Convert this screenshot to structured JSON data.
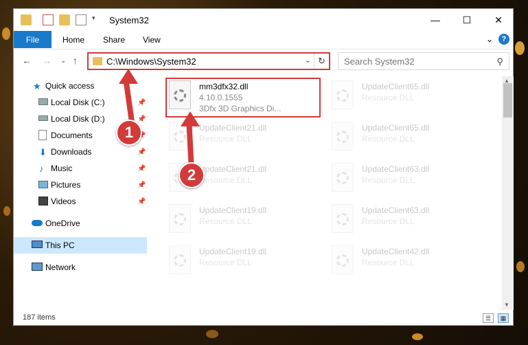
{
  "window": {
    "title": "System32",
    "minimize": "—",
    "maximize": "☐",
    "close": "✕"
  },
  "ribbon": {
    "tabs": [
      "File",
      "Home",
      "Share",
      "View"
    ],
    "expand": "⌄",
    "help": "?"
  },
  "nav": {
    "back": "←",
    "forward": "→",
    "recent": "⌄",
    "up": "↑",
    "address": "C:\\Windows\\System32",
    "search_placeholder": "Search System32"
  },
  "sidebar": {
    "items": [
      {
        "label": "Quick access",
        "icon": "star-icon",
        "pinned": false
      },
      {
        "label": "Local Disk (C:)",
        "icon": "drive-icon",
        "pinned": true
      },
      {
        "label": "Local Disk (D:)",
        "icon": "drive-icon",
        "pinned": true
      },
      {
        "label": "Documents",
        "icon": "document-icon",
        "pinned": true
      },
      {
        "label": "Downloads",
        "icon": "download-icon",
        "pinned": true
      },
      {
        "label": "Music",
        "icon": "music-icon",
        "pinned": true
      },
      {
        "label": "Pictures",
        "icon": "pictures-icon",
        "pinned": true
      },
      {
        "label": "Videos",
        "icon": "video-icon",
        "pinned": true
      },
      {
        "label": "OneDrive",
        "icon": "cloud-icon",
        "pinned": false
      },
      {
        "label": "This PC",
        "icon": "computer-icon",
        "pinned": false,
        "selected": true
      },
      {
        "label": "Network",
        "icon": "network-icon",
        "pinned": false
      }
    ]
  },
  "files": {
    "highlighted": {
      "name": "mm3dfx32.dll",
      "version": "4.10.0.1555",
      "desc": "3Dfx 3D Graphics Di..."
    },
    "left_column": [
      {
        "name": "UpdateClient21.dll",
        "type": "Resource DLL"
      },
      {
        "name": "UpdateClient21.dll",
        "type": "Resource DLL"
      },
      {
        "name": "UpdateClient19.dll",
        "type": "Resource DLL"
      },
      {
        "name": "UpdateClient19.dll",
        "type": "Resource DLL"
      }
    ],
    "right_column": [
      {
        "name": "UpdateClient65.dll",
        "type": "Resource DLL"
      },
      {
        "name": "UpdateClient65.dll",
        "type": "Resource DLL"
      },
      {
        "name": "UpdateClient63.dll",
        "type": "Resource DLL"
      },
      {
        "name": "UpdateClient63.dll",
        "type": "Resource DLL"
      },
      {
        "name": "UpdateClient42.dll",
        "type": "Resource DLL"
      }
    ]
  },
  "status": {
    "item_count": "187 items"
  },
  "callouts": [
    "1",
    "2"
  ],
  "colors": {
    "accent": "#1979ca",
    "highlight": "#d33a3a",
    "selected": "#cce8ff"
  }
}
